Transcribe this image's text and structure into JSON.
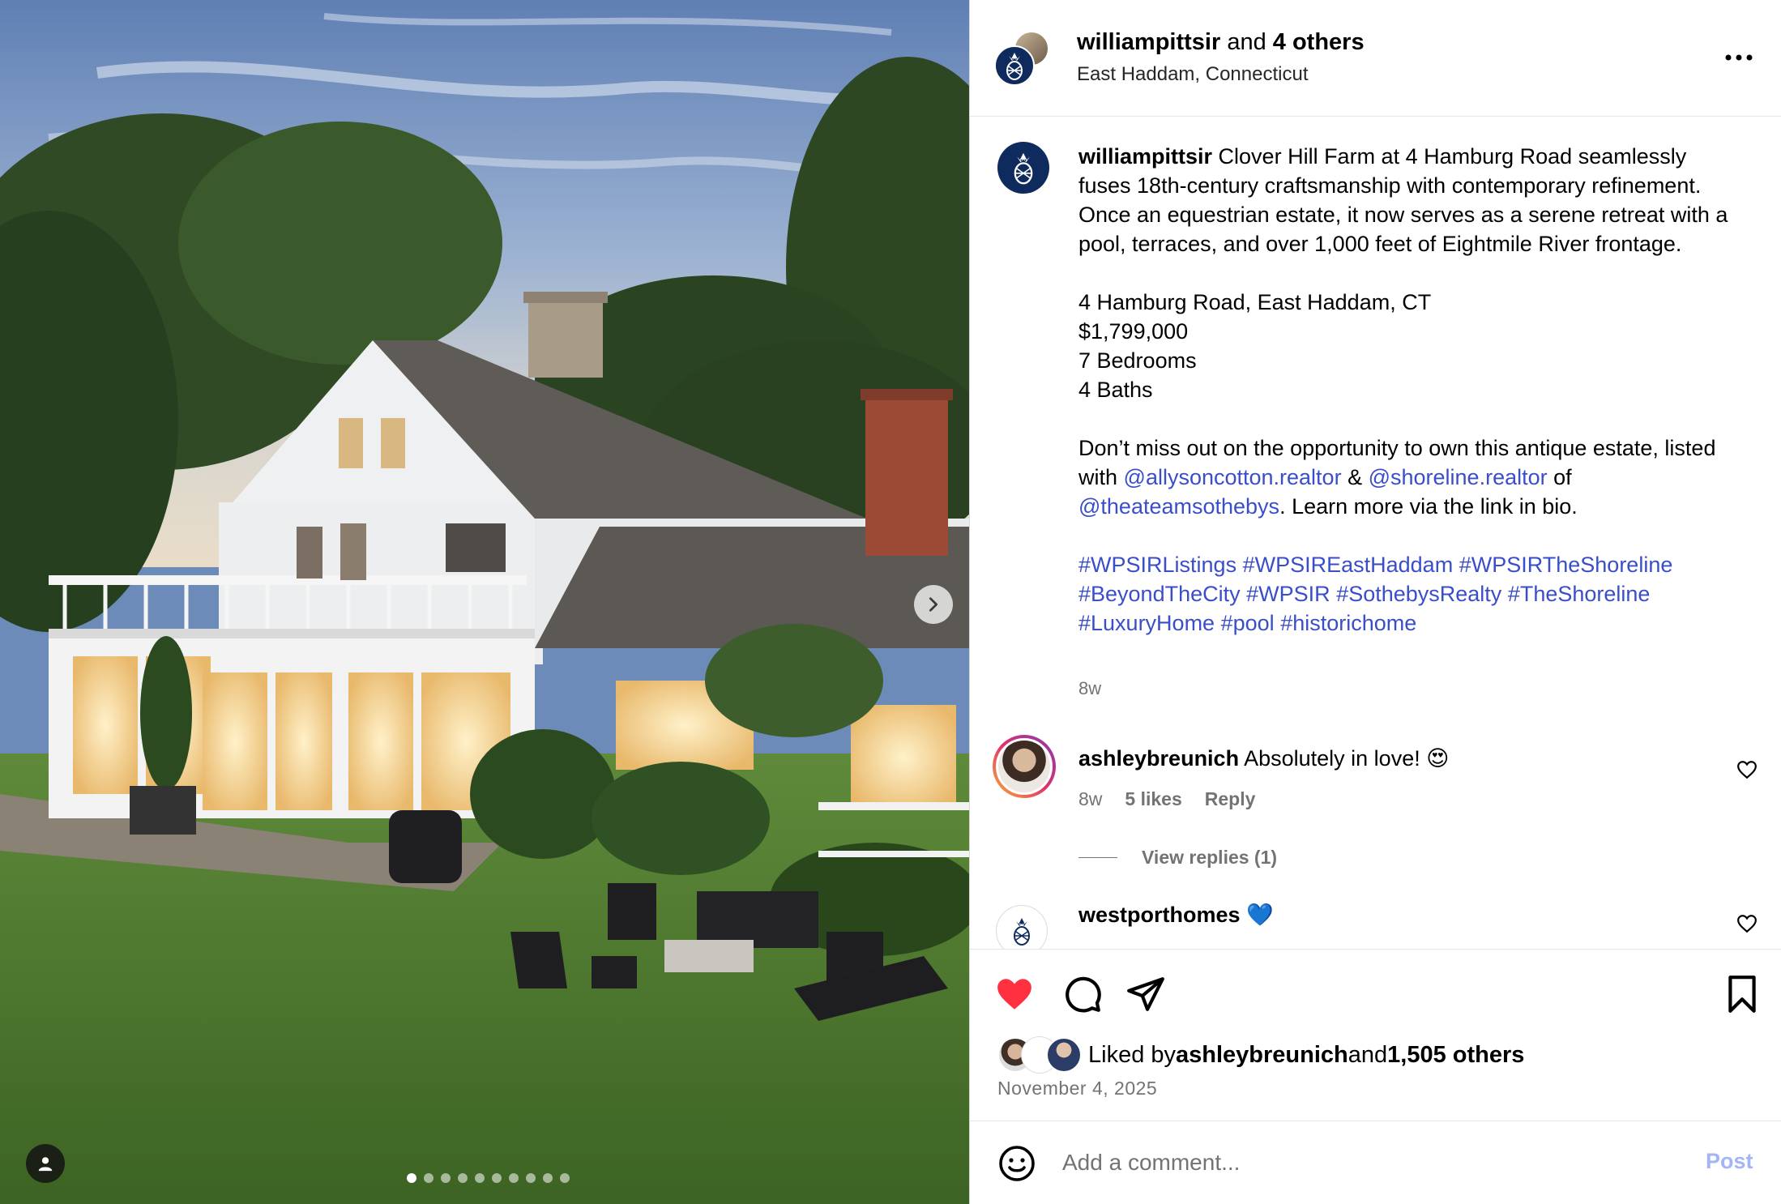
{
  "post": {
    "header": {
      "username": "williampittsir",
      "and_text": " and ",
      "others": "4 others",
      "location": "East Haddam, Connecticut"
    },
    "caption": {
      "username": "williampittsir",
      "intro": " Clover Hill Farm at 4 Hamburg Road seamlessly fuses 18th-century craftsmanship with contemporary refinement. Once an equestrian estate, it now serves as a serene retreat with a pool, terraces, and over 1,000 feet of Eightmile River frontage.",
      "address": "4 Hamburg Road, East Haddam, CT",
      "price": "$1,799,000",
      "bedrooms": "7 Bedrooms",
      "baths": "4 Baths",
      "cta_1": "Don’t miss out on the opportunity to own this antique estate, listed with ",
      "mention_1": "@allysoncotton.realtor",
      "amp": " & ",
      "mention_2": "@shoreline.realtor",
      "of_text": " of ",
      "mention_3": "@theateamsothebys",
      "cta_2": ". Learn more via the link in bio.",
      "hashtags": [
        "#WPSIRListings",
        "#WPSIREastHaddam",
        "#WPSIRTheShoreline",
        "#BeyondTheCity",
        "#WPSIR",
        "#SothebysRealty",
        "#TheShoreline",
        "#LuxuryHome",
        "#pool",
        "#historichome"
      ],
      "time": "8w"
    },
    "comments": [
      {
        "username": "ashleybreunich",
        "text": " Absolutely in love! 😍",
        "time": "8w",
        "likes": "5 likes",
        "reply_label": "Reply",
        "view_replies": "View replies (1)"
      },
      {
        "username": "westporthomes",
        "text": " 💙"
      }
    ],
    "likes": {
      "prefix": "Liked by ",
      "liker": "ashleybreunich",
      "and_text": " and ",
      "others": "1,505 others"
    },
    "date": "November 4, 2025",
    "comment_box": {
      "placeholder": "Add a comment...",
      "post_label": "Post"
    },
    "carousel": {
      "total_slides": 10,
      "active_index": 0
    },
    "colors": {
      "link": "#3a4ec9",
      "heart": "#ff3040",
      "brand_navy": "#0f2a5c",
      "post_button": "#a3b5f5",
      "muted_text": "#737373"
    },
    "icons": [
      "more-options-icon",
      "heart-icon",
      "comment-icon",
      "share-icon",
      "bookmark-icon",
      "emoji-icon",
      "chevron-right-icon",
      "user-tag-icon",
      "pineapple-logo-icon"
    ]
  }
}
